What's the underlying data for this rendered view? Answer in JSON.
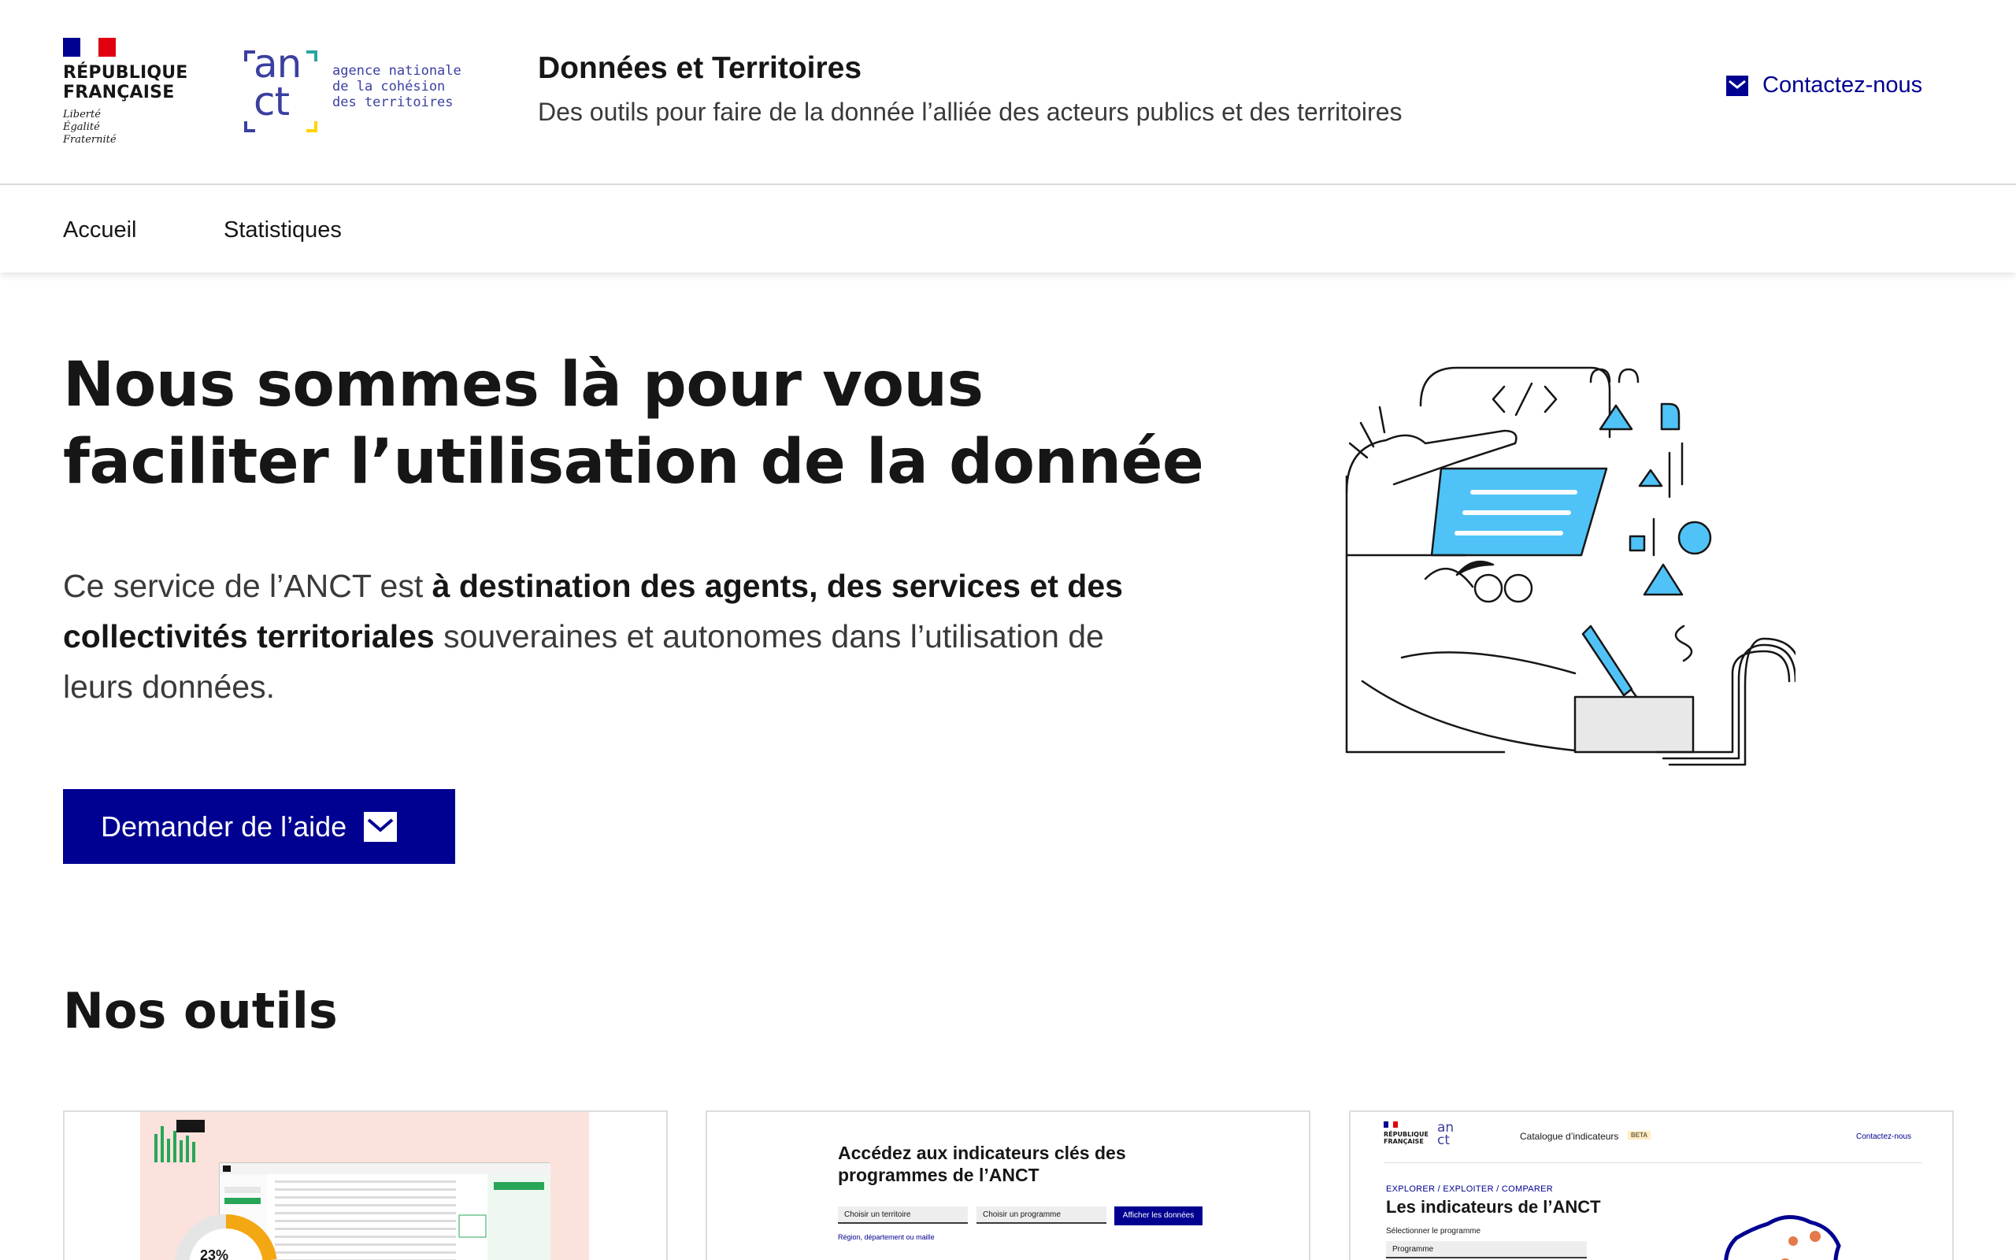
{
  "header": {
    "republique": "RÉPUBLIQUE\nFRANÇAISE",
    "motto": "Liberté\nÉgalité\nFraternité",
    "anct_mark_top": "an",
    "anct_mark_bottom": "ct",
    "anct_text": "agence nationale\nde la cohésion\ndes territoires",
    "site_title": "Données et Territoires",
    "tagline": "Des outils pour faire de la donnée l’alliée des acteurs publics et des territoires",
    "contact_label": "Contactez-nous",
    "contact_icon": "mail-icon"
  },
  "nav": {
    "items": [
      {
        "label": "Accueil"
      },
      {
        "label": "Statistiques"
      }
    ]
  },
  "hero": {
    "title": "Nous sommes là pour vous faciliter l’utilisation de la donnée",
    "text_before": "Ce service de l’ANCT est ",
    "text_bold": "à destination des agents, des services et des collectivités territoriales",
    "text_after": " souveraines et autonomes dans l’utilisation de leurs données.",
    "cta_label": "Demander de l’aide",
    "cta_icon": "mail-icon"
  },
  "tools": {
    "section_title": "Nos outils",
    "cards": [
      {
        "preview_percentage": "23%"
      },
      {
        "preview_title": "Accédez aux indicateurs clés des programmes de l’ANCT",
        "select_territory": "Choisir un territoire",
        "select_program": "Choisir un programme",
        "button_label": "Afficher les données",
        "checkbox_label": "Région, département ou maille"
      },
      {
        "mini_republique": "RÉPUBLIQUE\nFRANÇAISE",
        "mini_anct": "an\n ct",
        "catalog_label": "Catalogue d’indicateurs",
        "beta_badge": "BETA",
        "contact_label": "Contactez-nous",
        "kicker": "EXPLORER / EXPLOITER / COMPARER",
        "title": "Les indicateurs de l’ANCT",
        "select_label": "Sélectionner le programme",
        "select_value": "Programme"
      }
    ]
  },
  "colors": {
    "primary": "#000091",
    "illustration_accent": "#4fc3f7",
    "flag_red": "#e1000f"
  }
}
